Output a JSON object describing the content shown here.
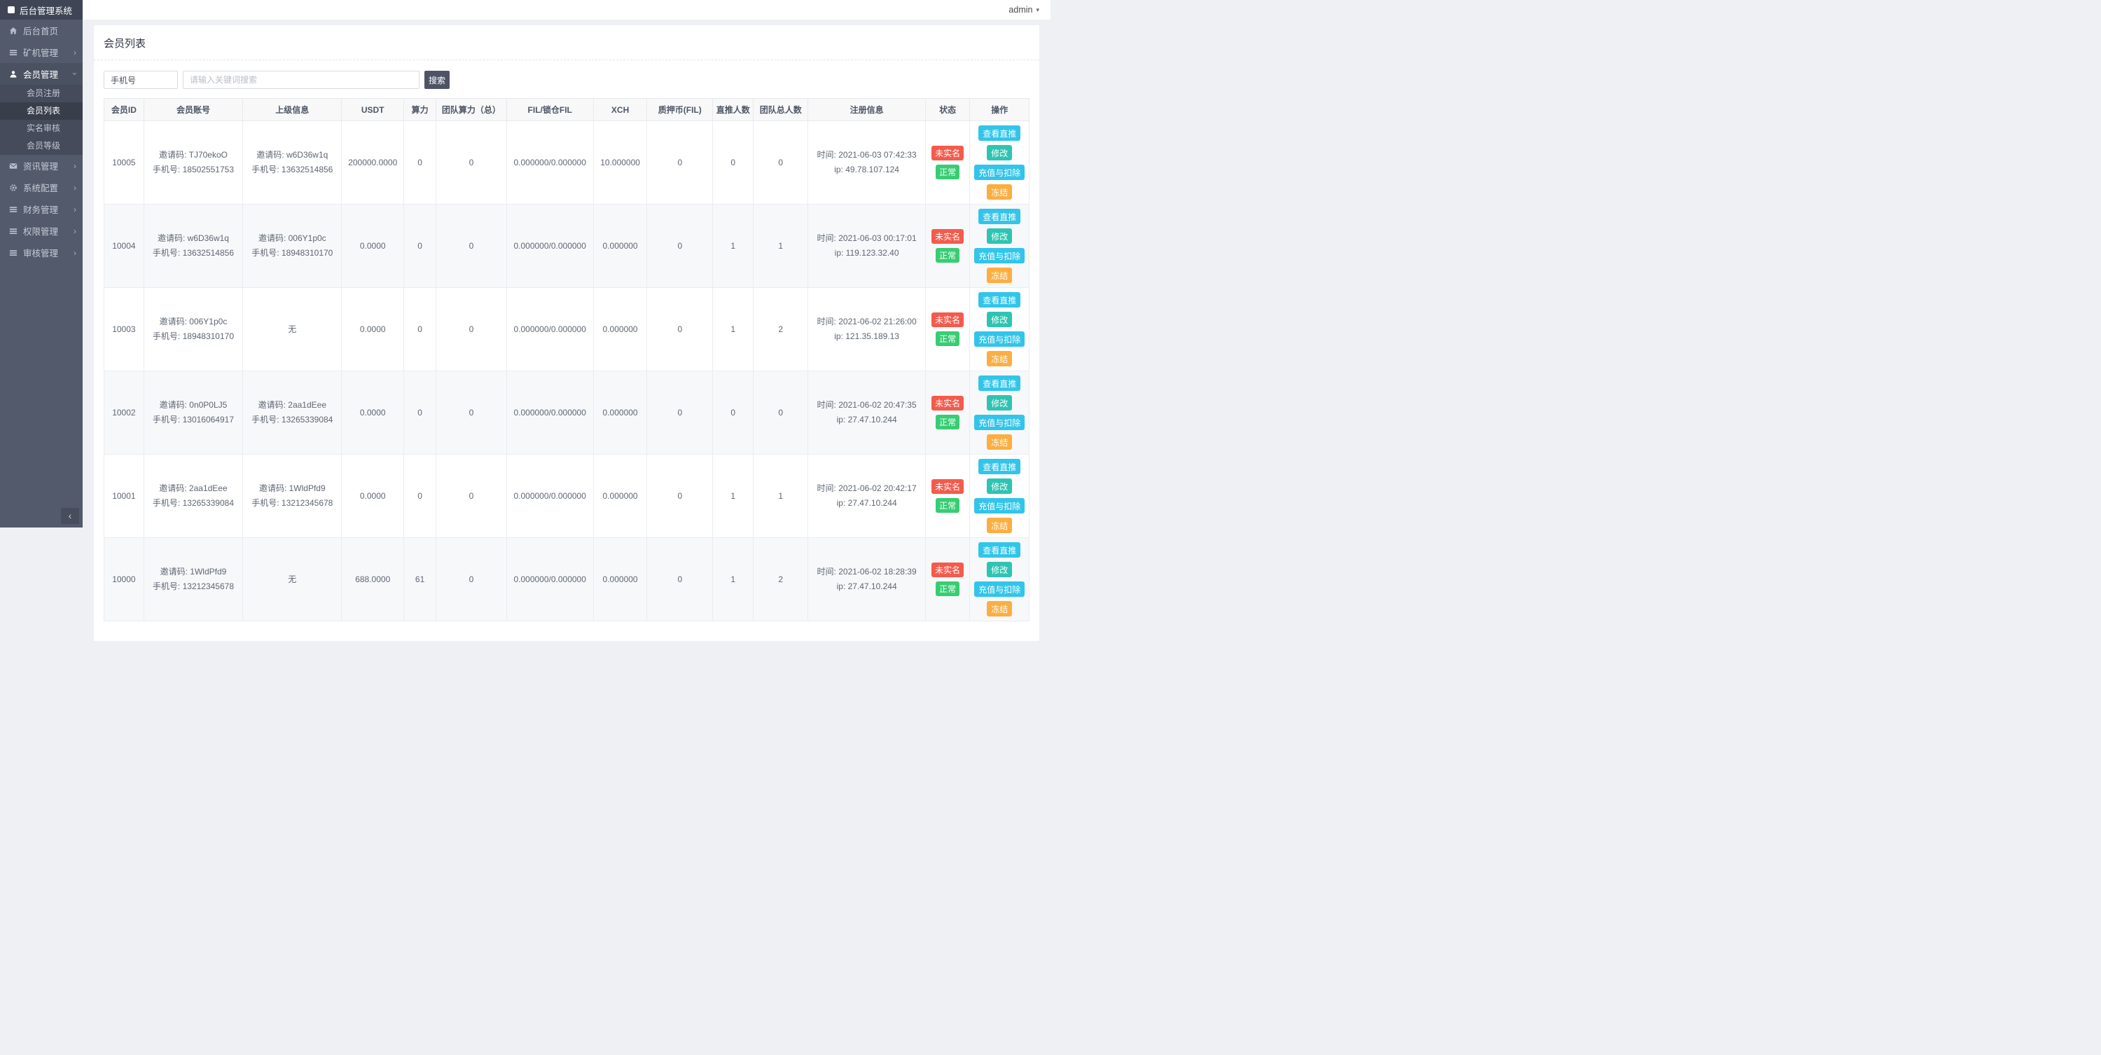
{
  "app": {
    "logo_title": "后台管理系统",
    "header": {
      "username": "admin",
      "caret_icon": "▾"
    }
  },
  "sidebar": {
    "active_child": "会员列表",
    "collapse_icon": "‹",
    "items": [
      {
        "label": "后台首页",
        "icon": "home-icon"
      },
      {
        "label": "矿机管理",
        "icon": "menu-icon",
        "chevron": "right"
      },
      {
        "label": "会员管理",
        "icon": "user-icon",
        "chevron": "down",
        "expanded": true,
        "children": [
          "会员注册",
          "会员列表",
          "实名审核",
          "会员等级"
        ]
      },
      {
        "label": "资讯管理",
        "icon": "mail-icon",
        "chevron": "right"
      },
      {
        "label": "系统配置",
        "icon": "gear-icon",
        "chevron": "right"
      },
      {
        "label": "财务管理",
        "icon": "menu-icon",
        "chevron": "right"
      },
      {
        "label": "权限管理",
        "icon": "menu-icon",
        "chevron": "right"
      },
      {
        "label": "审核管理",
        "icon": "menu-icon",
        "chevron": "right"
      }
    ]
  },
  "page": {
    "title": "会员列表"
  },
  "search": {
    "field_selector": "手机号",
    "keyword_placeholder": "请输入关键词搜索",
    "button_label": "搜索"
  },
  "table": {
    "columns": [
      "会员ID",
      "会员账号",
      "上级信息",
      "USDT",
      "算力",
      "团队算力（总）",
      "FIL/锁仓FIL",
      "XCH",
      "质押币(FIL)",
      "直推人数",
      "团队总人数",
      "注册信息",
      "状态",
      "操作"
    ],
    "row_actions": [
      {
        "label": "查看直推",
        "type": "cyan",
        "name": "view-direct-button"
      },
      {
        "label": "修改",
        "type": "teal",
        "name": "edit-button"
      },
      {
        "label": "充值与扣除",
        "type": "cyan",
        "name": "recharge-deduct-button"
      },
      {
        "label": "冻结",
        "type": "orange",
        "name": "freeze-button"
      }
    ],
    "rows": [
      {
        "id": "10005",
        "account": [
          "邀请码: TJ70ekoO",
          "手机号: 18502551753"
        ],
        "parent": [
          "邀请码: w6D36w1q",
          "手机号: 13632514856"
        ],
        "usdt": "200000.0000",
        "power": "0",
        "team_power": "0",
        "fil": "0.000000/0.000000",
        "xch": "10.000000",
        "pledge": "0",
        "direct_count": "0",
        "team_count": "0",
        "register": [
          "时间: 2021-06-03 07:42:33",
          "ip: 49.78.107.124"
        ],
        "status": [
          {
            "text": "未实名",
            "type": "red",
            "name": "status-badge-unverified"
          },
          {
            "text": "正常",
            "type": "green",
            "name": "status-badge-normal"
          }
        ]
      },
      {
        "id": "10004",
        "account": [
          "邀请码: w6D36w1q",
          "手机号: 13632514856"
        ],
        "parent": [
          "邀请码: 006Y1p0c",
          "手机号: 18948310170"
        ],
        "usdt": "0.0000",
        "power": "0",
        "team_power": "0",
        "fil": "0.000000/0.000000",
        "xch": "0.000000",
        "pledge": "0",
        "direct_count": "1",
        "team_count": "1",
        "register": [
          "时间: 2021-06-03 00:17:01",
          "ip: 119.123.32.40"
        ],
        "status": [
          {
            "text": "未实名",
            "type": "red",
            "name": "status-badge-unverified"
          },
          {
            "text": "正常",
            "type": "green",
            "name": "status-badge-normal"
          }
        ]
      },
      {
        "id": "10003",
        "account": [
          "邀请码: 006Y1p0c",
          "手机号: 18948310170"
        ],
        "parent": [
          "无"
        ],
        "usdt": "0.0000",
        "power": "0",
        "team_power": "0",
        "fil": "0.000000/0.000000",
        "xch": "0.000000",
        "pledge": "0",
        "direct_count": "1",
        "team_count": "2",
        "register": [
          "时间: 2021-06-02 21:26:00",
          "ip: 121.35.189.13"
        ],
        "status": [
          {
            "text": "未实名",
            "type": "red",
            "name": "status-badge-unverified"
          },
          {
            "text": "正常",
            "type": "green",
            "name": "status-badge-normal"
          }
        ]
      },
      {
        "id": "10002",
        "account": [
          "邀请码: 0n0P0LJ5",
          "手机号: 13016064917"
        ],
        "parent": [
          "邀请码: 2aa1dEee",
          "手机号: 13265339084"
        ],
        "usdt": "0.0000",
        "power": "0",
        "team_power": "0",
        "fil": "0.000000/0.000000",
        "xch": "0.000000",
        "pledge": "0",
        "direct_count": "0",
        "team_count": "0",
        "register": [
          "时间: 2021-06-02 20:47:35",
          "ip: 27.47.10.244"
        ],
        "status": [
          {
            "text": "未实名",
            "type": "red",
            "name": "status-badge-unverified"
          },
          {
            "text": "正常",
            "type": "green",
            "name": "status-badge-normal"
          }
        ]
      },
      {
        "id": "10001",
        "account": [
          "邀请码: 2aa1dEee",
          "手机号: 13265339084"
        ],
        "parent": [
          "邀请码: 1WldPfd9",
          "手机号: 13212345678"
        ],
        "usdt": "0.0000",
        "power": "0",
        "team_power": "0",
        "fil": "0.000000/0.000000",
        "xch": "0.000000",
        "pledge": "0",
        "direct_count": "1",
        "team_count": "1",
        "register": [
          "时间: 2021-06-02 20:42:17",
          "ip: 27.47.10.244"
        ],
        "status": [
          {
            "text": "未实名",
            "type": "red",
            "name": "status-badge-unverified"
          },
          {
            "text": "正常",
            "type": "green",
            "name": "status-badge-normal"
          }
        ]
      },
      {
        "id": "10000",
        "account": [
          "邀请码: 1WldPfd9",
          "手机号: 13212345678"
        ],
        "parent": [
          "无"
        ],
        "usdt": "688.0000",
        "power": "61",
        "team_power": "0",
        "fil": "0.000000/0.000000",
        "xch": "0.000000",
        "pledge": "0",
        "direct_count": "1",
        "team_count": "2",
        "register": [
          "时间: 2021-06-02 18:28:39",
          "ip: 27.47.10.244"
        ],
        "status": [
          {
            "text": "未实名",
            "type": "red",
            "name": "status-badge-unverified"
          },
          {
            "text": "正常",
            "type": "green",
            "name": "status-badge-normal"
          }
        ]
      }
    ]
  },
  "colors": {
    "action_cyan": "#32c5e9",
    "action_teal": "#2dc5b2",
    "action_orange": "#fcae41",
    "badge_red": "#f45b4d",
    "badge_green": "#38cd73",
    "search_button": "#4e5465",
    "sidebar_bg": "#525a6b"
  }
}
